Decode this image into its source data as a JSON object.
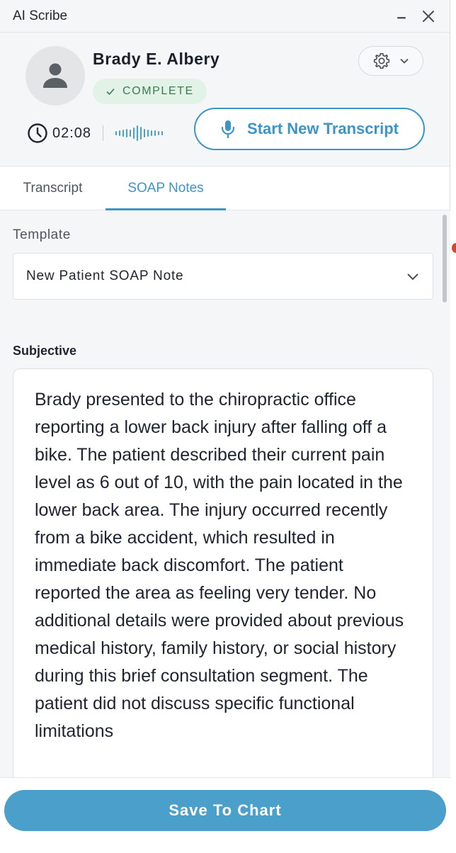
{
  "window": {
    "title": "AI Scribe"
  },
  "icons": {
    "minimize": "minimize-icon",
    "close": "close-icon",
    "avatar": "person-icon",
    "check": "check-icon",
    "gear": "gear-icon",
    "chevron": "chevron-down-icon",
    "clock": "clock-icon",
    "waveform": "waveform-icon",
    "mic": "microphone-icon"
  },
  "patient": {
    "name": "Brady E. Albery"
  },
  "status": {
    "label": "COMPLETE",
    "color": "#3b7a50"
  },
  "recording": {
    "elapsed": "02:08"
  },
  "actions": {
    "new_transcript": "Start New Transcript",
    "save": "Save To Chart"
  },
  "tabs": [
    {
      "label": "Transcript",
      "active": false
    },
    {
      "label": "SOAP Notes",
      "active": true
    }
  ],
  "template": {
    "label": "Template",
    "selected": "New Patient SOAP Note"
  },
  "subjective": {
    "label": "Subjective",
    "text": "Brady presented to the chiropractic office reporting a lower back injury after falling off a bike. The patient described their current pain level as 6 out of 10, with the pain located in the lower back area. The injury occurred recently from a bike accident, which resulted in immediate back discomfort. The patient reported the area as feeling very tender. No additional details were provided about previous medical history, family history, or social history during this brief consultation segment. The patient did not discuss specific functional limitations"
  },
  "colors": {
    "accent": "#3b95c7",
    "save_button": "#4a9fcb",
    "badge_bg": "#e2f2e7"
  }
}
